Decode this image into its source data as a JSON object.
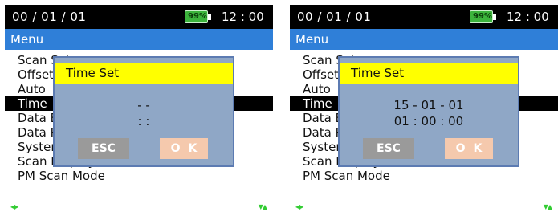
{
  "screens": [
    {
      "status": {
        "date": "00 / 01 / 01",
        "battery": "99%",
        "time": "12 : 00"
      },
      "menu_header": "Menu",
      "menu_items": [
        {
          "label": "Scan Setup",
          "selected": false
        },
        {
          "label": "Offset",
          "selected": false
        },
        {
          "label": "Auto",
          "selected": false
        },
        {
          "label": "Time",
          "selected": true
        },
        {
          "label": "Data Backup",
          "selected": false
        },
        {
          "label": "Data Restore",
          "selected": false
        },
        {
          "label": "System Info",
          "selected": false
        },
        {
          "label": "Scan Display",
          "selected": false
        },
        {
          "label": "PM Scan Mode",
          "selected": false
        }
      ],
      "dialog": {
        "title": "Time Set",
        "date_value": "-  -",
        "time_value": ":  :",
        "esc_label": "ESC",
        "ok_label": "OK"
      }
    },
    {
      "status": {
        "date": "00 / 01 / 01",
        "battery": "99%",
        "time": "12 : 00"
      },
      "menu_header": "Menu",
      "menu_items": [
        {
          "label": "Scan Setup",
          "selected": false
        },
        {
          "label": "Offset",
          "selected": false
        },
        {
          "label": "Auto",
          "selected": false
        },
        {
          "label": "Time",
          "selected": true
        },
        {
          "label": "Data Backup",
          "selected": false
        },
        {
          "label": "Data Restore",
          "selected": false
        },
        {
          "label": "System Info",
          "selected": false
        },
        {
          "label": "Scan Display",
          "selected": false
        },
        {
          "label": "PM Scan Mode",
          "selected": false
        }
      ],
      "dialog": {
        "title": "Time Set",
        "date_value": "15 - 01 - 01",
        "time_value": "01 : 00 : 00",
        "esc_label": "ESC",
        "ok_label": "OK"
      }
    }
  ],
  "nav": {
    "left_right_icon": "left-right-arrows-icon",
    "up_down_icon": "up-down-arrows-icon"
  },
  "colors": {
    "status_bar": "#000000",
    "menu_header": "#2f7fd8",
    "dialog_bg": "#8fa7c6",
    "dialog_title": "#ffff00",
    "esc_button": "#9a9a9a",
    "ok_button": "#f5c9ad",
    "battery": "#3cb43c",
    "nav_arrows": "#33cc33"
  }
}
